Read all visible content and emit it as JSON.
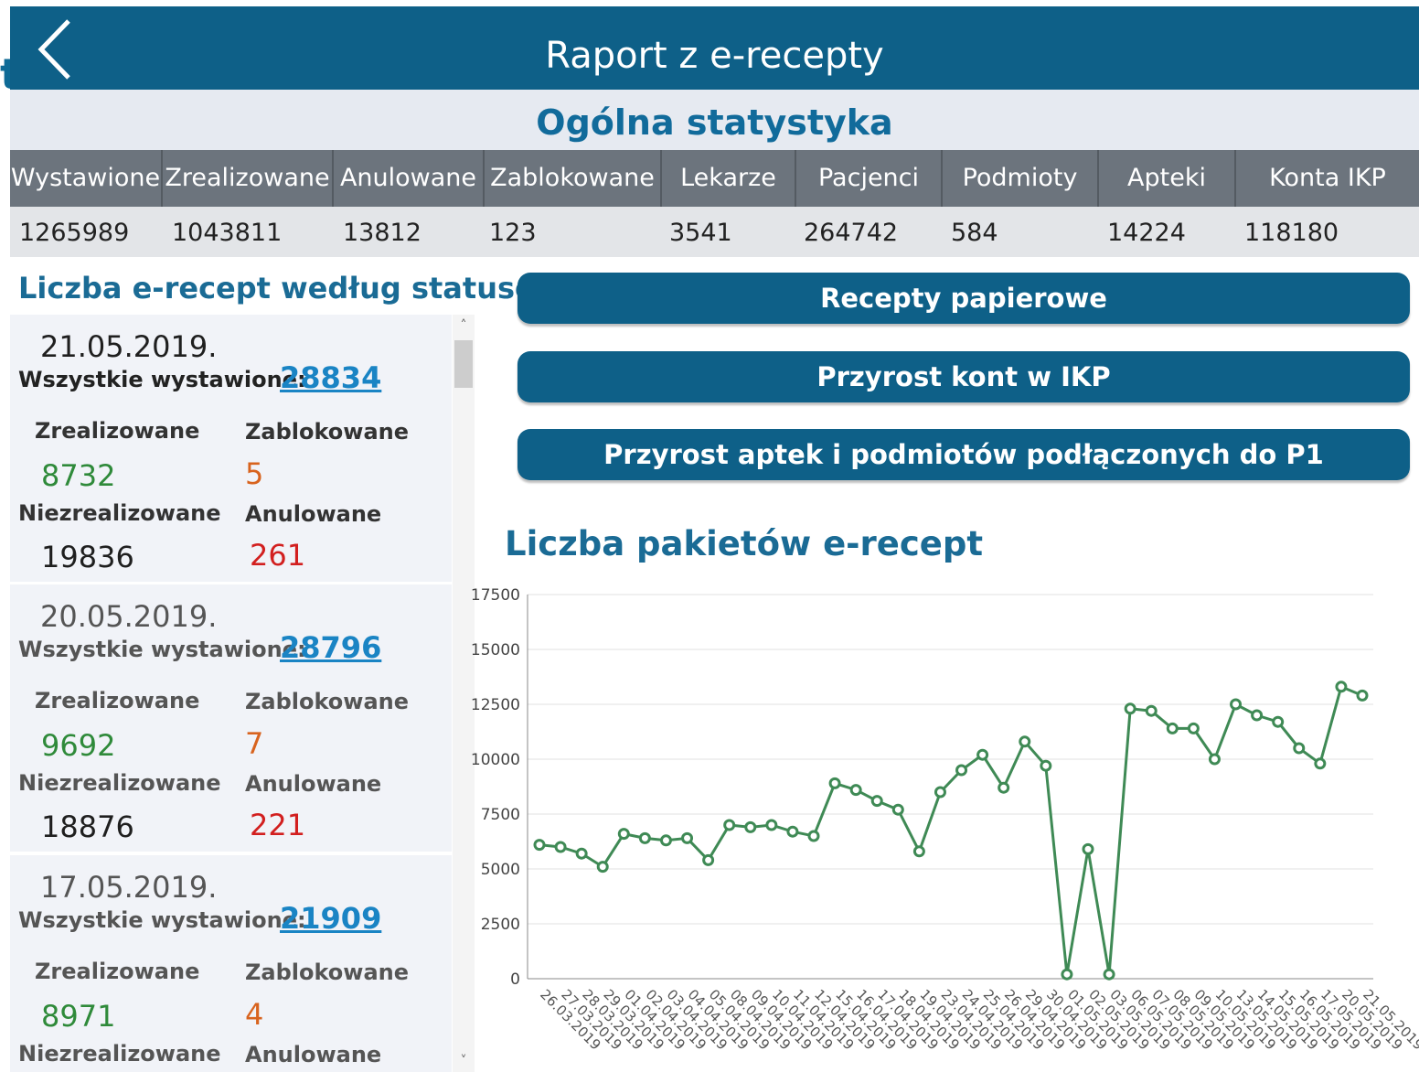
{
  "edge_glyph": "t",
  "header": {
    "title": "Raport z e-recepty"
  },
  "section_title": "Ogólna statystyka",
  "stats": {
    "headers": [
      "Wystawione",
      "Zrealizowane",
      "Anulowane",
      "Zablokowane",
      "Lekarze",
      "Pacjenci",
      "Podmioty",
      "Apteki",
      "Konta IKP"
    ],
    "values": [
      "1265989",
      "1043811",
      "13812",
      "123",
      "3541",
      "264742",
      "584",
      "14224",
      "118180"
    ]
  },
  "left_panel": {
    "title": "Liczba e-recept według statusów",
    "all_label": "Wszystkie wystawione:",
    "labels": {
      "realized": "Zrealizowane",
      "blocked": "Zablokowane",
      "unrealized": "Niezrealizowane",
      "cancelled": "Anulowane"
    },
    "cards": [
      {
        "date": "21.05.2019.",
        "all": "28834",
        "realized": "8732",
        "blocked": "5",
        "unrealized": "19836",
        "cancelled": "261"
      },
      {
        "date": "20.05.2019.",
        "all": "28796",
        "realized": "9692",
        "blocked": "7",
        "unrealized": "18876",
        "cancelled": "221"
      },
      {
        "date": "17.05.2019.",
        "all": "21909",
        "realized": "8971",
        "blocked": "4",
        "unrealized": "",
        "cancelled": ""
      }
    ]
  },
  "buttons": [
    "Recepty papierowe",
    "Przyrost kont w IKP",
    "Przyrost aptek i podmiotów podłączonych do P1"
  ],
  "colors": {
    "header": "#0e6088",
    "accent": "#1a6b95",
    "line": "#3f8a55"
  },
  "icons": {
    "back": "chevron-left-icon",
    "scroll_up": "chevron-up-icon",
    "scroll_down": "chevron-down-icon"
  },
  "chart_data": {
    "type": "line",
    "title": "Liczba pakietów e-recept",
    "xlabel": "",
    "ylabel": "",
    "ylim": [
      0,
      17500
    ],
    "yticks": [
      0,
      2500,
      5000,
      7500,
      10000,
      12500,
      15000,
      17500
    ],
    "grid": true,
    "x": [
      "26.03.2019",
      "27.03.2019",
      "28.03.2019",
      "29.03.2019",
      "01.04.2019",
      "02.04.2019",
      "03.04.2019",
      "04.04.2019",
      "05.04.2019",
      "08.04.2019",
      "09.04.2019",
      "10.04.2019",
      "11.04.2019",
      "12.04.2019",
      "15.04.2019",
      "16.04.2019",
      "17.04.2019",
      "18.04.2019",
      "19.04.2019",
      "23.04.2019",
      "24.04.2019",
      "25.04.2019",
      "26.04.2019",
      "29.04.2019",
      "30.04.2019",
      "01.05.2019",
      "02.05.2019",
      "03.05.2019",
      "06.05.2019",
      "07.05.2019",
      "08.05.2019",
      "09.05.2019",
      "10.05.2019",
      "13.05.2019",
      "14.05.2019",
      "15.05.2019",
      "16.05.2019",
      "17.05.2019",
      "20.05.2019",
      "21.05.2019"
    ],
    "series": [
      {
        "values": [
          6100,
          6000,
          5700,
          5100,
          6600,
          6400,
          6300,
          6400,
          5400,
          7000,
          6900,
          7000,
          6700,
          6500,
          8900,
          8600,
          8100,
          7700,
          5800,
          8500,
          9500,
          10200,
          8700,
          10800,
          9700,
          200,
          5900,
          200,
          12300,
          12200,
          11400,
          11400,
          10000,
          12500,
          12000,
          11700,
          10500,
          9800,
          13300,
          12900
        ]
      }
    ]
  }
}
